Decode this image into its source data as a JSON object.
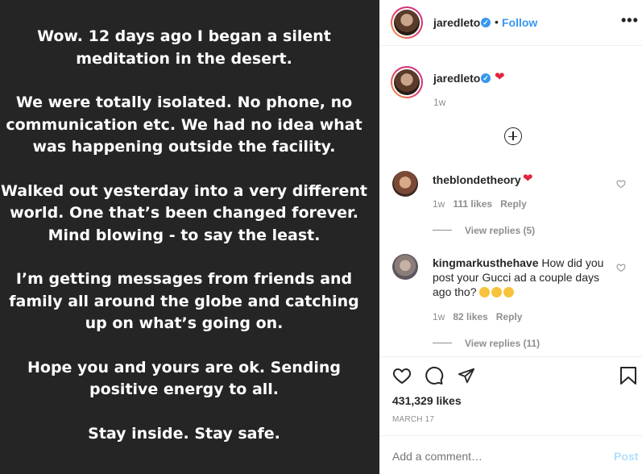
{
  "post": {
    "paragraphs": [
      [
        "Wow. 12 days ago I began a silent",
        "meditation in the desert."
      ],
      [
        "We were totally isolated. No phone, no",
        "communication etc. We had no idea what",
        "was happening outside the facility."
      ],
      [
        "Walked out yesterday into a very different",
        "world. One that’s been changed forever.",
        "Mind blowing - to say the least."
      ],
      [
        "I’m getting messages from friends and",
        "family all around the globe and catching",
        "up on what’s going on."
      ],
      [
        "Hope you and yours are ok. Sending",
        "positive energy to all."
      ],
      [
        "Stay inside. Stay safe."
      ]
    ]
  },
  "header": {
    "username": "jaredleto",
    "separator": "•",
    "follow_label": "Follow",
    "more_label": "•••"
  },
  "caption": {
    "username": "jaredleto",
    "emoji": "❤",
    "time": "1w"
  },
  "load_more_icon": "plus-circle-icon",
  "comments": [
    {
      "username": "theblondetheory",
      "text": "",
      "emoji": "❤",
      "time": "1w",
      "likes": "111 likes",
      "reply_label": "Reply",
      "view_replies": "View replies (5)"
    },
    {
      "username": "kingmarkusthehave",
      "text_line1": "How did you",
      "text_line2": "post your Gucci ad a couple days",
      "text_line3": "ago tho?",
      "emoji_icons": [
        "thinking-face-icon",
        "thinking-face-icon",
        "thinking-face-icon"
      ],
      "time": "1w",
      "likes": "82 likes",
      "reply_label": "Reply",
      "view_replies": "View replies (11)"
    }
  ],
  "actions": {
    "likes": "431,329 likes",
    "date": "MARCH 17"
  },
  "add_comment": {
    "placeholder": "Add a comment…",
    "post_label": "Post"
  },
  "colors": {
    "accent": "#3897f0",
    "heart": "#e0243f",
    "left_bg": "#252525"
  }
}
